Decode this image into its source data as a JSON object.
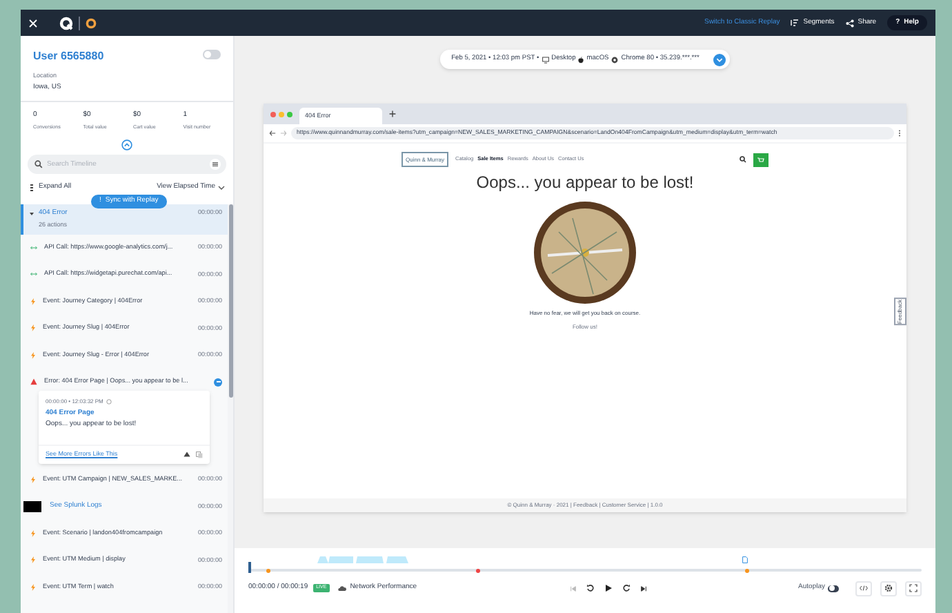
{
  "top_bar": {
    "classic_link": "Switch to Classic Replay",
    "buttons": [
      {
        "kind": "segments",
        "label": "Segments"
      },
      {
        "kind": "share",
        "label": "Share"
      },
      {
        "kind": "help",
        "icon": "?",
        "label": "Help"
      }
    ]
  },
  "user": {
    "name": "User 6565880",
    "location_label": "Location",
    "location": "Iowa, US",
    "toggle_on": false
  },
  "stats": [
    {
      "value": "0",
      "label": "Conversions"
    },
    {
      "value": "$0",
      "label": "Total value"
    },
    {
      "value": "$0",
      "label": "Cart value"
    },
    {
      "value": "1",
      "label": "Visit number"
    }
  ],
  "search": {
    "placeholder": "Search Timeline"
  },
  "expand_all": "Expand All",
  "view_mode": "View Elapsed Time",
  "sync_button": {
    "icon": "!",
    "label": "Sync with Replay"
  },
  "timeline": {
    "group": {
      "title": "404 Error",
      "subtitle": "26 actions",
      "time": "00:00:00",
      "expanded": true,
      "selected": true
    },
    "items": [
      {
        "kind": "api",
        "label": "API Call: https://www.google-analytics.com/j...",
        "time": "00:00:00"
      },
      {
        "kind": "api",
        "label": "API Call: https://widgetapi.purechat.com/api...",
        "time": "00:00:00"
      },
      {
        "kind": "event",
        "label": "Event: Journey Category | 404Error",
        "time": "00:00:00"
      },
      {
        "kind": "event",
        "label": "Event: Journey Slug | 404Error",
        "time": "00:00:00"
      },
      {
        "kind": "event",
        "label": "Event: Journey Slug - Error | 404Error",
        "time": "00:00:00"
      },
      {
        "kind": "error",
        "label": "Error: 404 Error Page | Oops... you appear to be l...",
        "expanded": true,
        "detail": {
          "time": "00:00:00 • 12:03:32 PM",
          "title": "404 Error Page",
          "message": "Oops... you appear to be lost!",
          "link": "See More Errors Like This"
        }
      },
      {
        "kind": "event",
        "label": "Event: UTM Campaign | NEW_SALES_MARKE...",
        "time": "00:00:00"
      },
      {
        "kind": "splunk",
        "label": "See Splunk Logs",
        "time": "00:00:00"
      },
      {
        "kind": "event",
        "label": "Event: Scenario | landon404fromcampaign",
        "time": "00:00:00"
      },
      {
        "kind": "event",
        "label": "Event: UTM Medium | display",
        "time": "00:00:00"
      },
      {
        "kind": "event",
        "label": "Event: UTM Term | watch",
        "time": "00:00:00"
      }
    ]
  },
  "session": [
    {
      "kind": "date",
      "text": "Feb 5, 2021 • 12:03 pm PST •"
    },
    {
      "kind": "desktop",
      "text": "Desktop"
    },
    {
      "kind": "apple",
      "text": "macOS"
    },
    {
      "kind": "chrome",
      "text": "Chrome 80 • 35.239.***.***"
    }
  ],
  "browser": {
    "tab": "404 Error",
    "url": "https://www.quinnandmurray.com/sale-items?utm_campaign=NEW_SALES_MARKETING_CAMPAIGN&scenario=LandOn404FromCampaign&utm_medium=display&utm_term=watch",
    "site": {
      "logo": "Quinn & Murray",
      "nav": [
        {
          "label": "Catalog",
          "selected": false
        },
        {
          "label": "Sale Items",
          "selected": true
        },
        {
          "label": "Rewards",
          "selected": false
        },
        {
          "label": "About Us",
          "selected": false
        },
        {
          "label": "Contact Us",
          "selected": false
        }
      ],
      "heading": "Oops... you appear to be lost!",
      "message": "Have no fear, we will get you back on course.",
      "follow": "Follow us!",
      "footer": "© Quinn & Murray · 2021 | Feedback | Customer Service | 1.0.0",
      "feedback_tab": "Feedback"
    }
  },
  "player": {
    "time": "00:00:00 / 00:00:19",
    "badge": "LIVE",
    "network": "Network Performance",
    "autoplay": "Autoplay",
    "autoplay_on": false,
    "level": 0
  }
}
